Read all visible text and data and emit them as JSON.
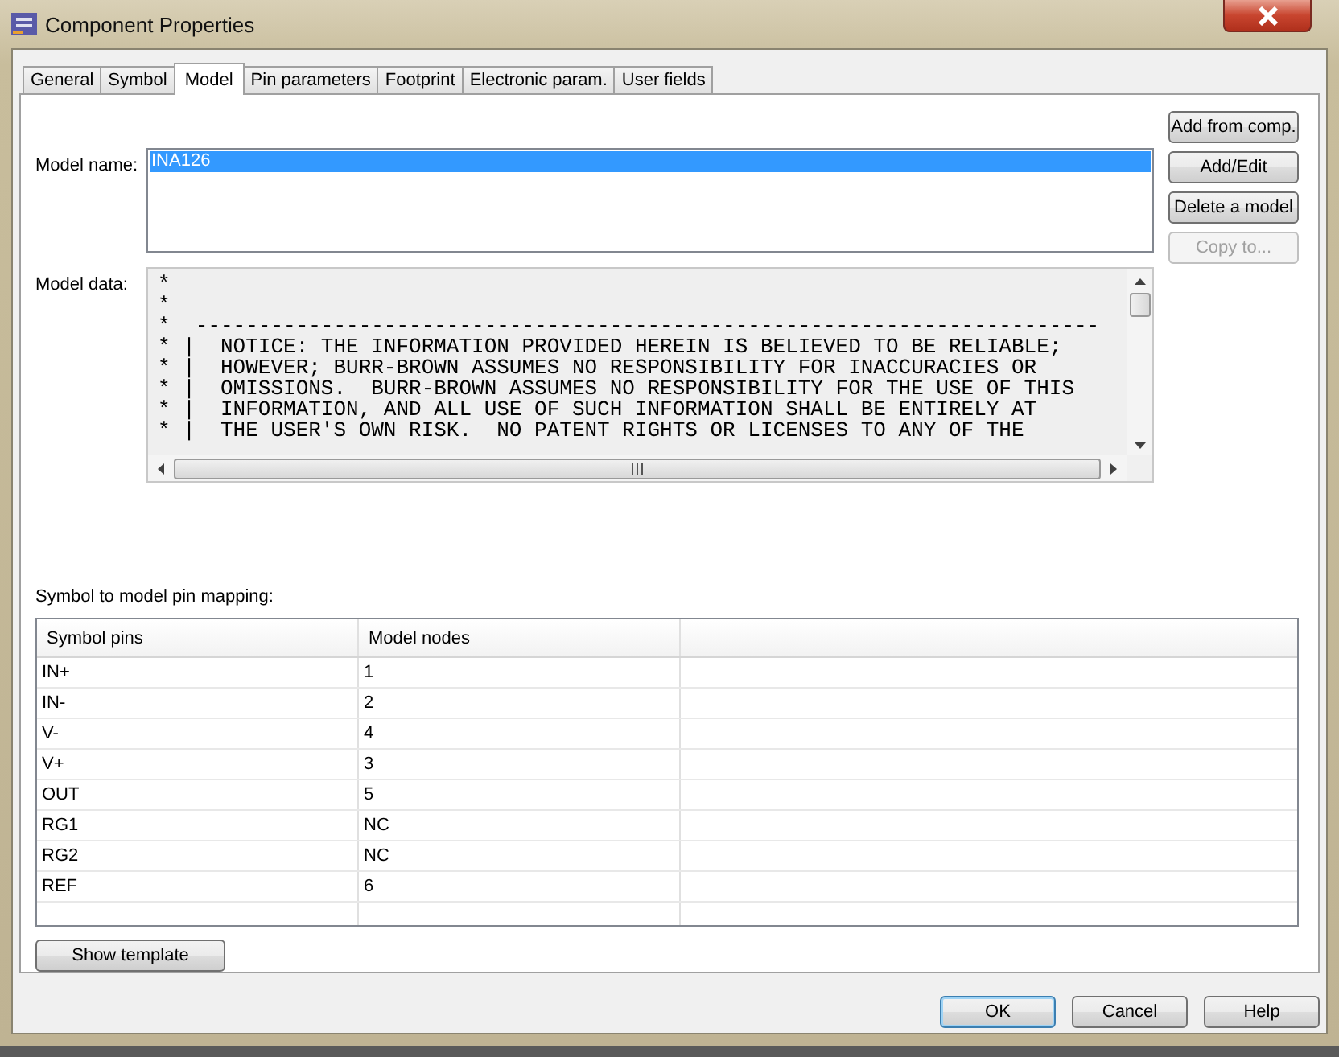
{
  "window": {
    "title": "Component Properties"
  },
  "tabs": [
    {
      "label": "General",
      "selected": false
    },
    {
      "label": "Symbol",
      "selected": false
    },
    {
      "label": "Model",
      "selected": true
    },
    {
      "label": "Pin parameters",
      "selected": false
    },
    {
      "label": "Footprint",
      "selected": false
    },
    {
      "label": "Electronic param.",
      "selected": false
    },
    {
      "label": "User fields",
      "selected": false
    }
  ],
  "model_name": {
    "label": "Model name:",
    "items": [
      {
        "text": "INA126",
        "selected": true
      }
    ]
  },
  "model_data": {
    "label": "Model data:",
    "lines": [
      "*",
      "*",
      "*  ------------------------------------------------------------------------",
      "* |  NOTICE: THE INFORMATION PROVIDED HEREIN IS BELIEVED TO BE RELIABLE;",
      "* |  HOWEVER; BURR-BROWN ASSUMES NO RESPONSIBILITY FOR INACCURACIES OR",
      "* |  OMISSIONS.  BURR-BROWN ASSUMES NO RESPONSIBILITY FOR THE USE OF THIS",
      "* |  INFORMATION, AND ALL USE OF SUCH INFORMATION SHALL BE ENTIRELY AT",
      "* |  THE USER'S OWN RISK.  NO PATENT RIGHTS OR LICENSES TO ANY OF THE"
    ]
  },
  "side_buttons": [
    {
      "label": "Add from comp.",
      "disabled": false
    },
    {
      "label": "Add/Edit",
      "disabled": false
    },
    {
      "label": "Delete a model",
      "disabled": false
    },
    {
      "label": "Copy to...",
      "disabled": true
    }
  ],
  "pin_mapping": {
    "label": "Symbol to model pin mapping:",
    "columns": [
      "Symbol pins",
      "Model nodes"
    ],
    "rows": [
      [
        "IN+",
        "1"
      ],
      [
        "IN-",
        "2"
      ],
      [
        "V-",
        "4"
      ],
      [
        "V+",
        "3"
      ],
      [
        "OUT",
        "5"
      ],
      [
        "RG1",
        "NC"
      ],
      [
        "RG2",
        "NC"
      ],
      [
        "REF",
        "6"
      ]
    ]
  },
  "show_template_button": "Show template",
  "dialog_buttons": [
    {
      "label": "OK",
      "default": true
    },
    {
      "label": "Cancel",
      "default": false
    },
    {
      "label": "Help",
      "default": false
    }
  ]
}
